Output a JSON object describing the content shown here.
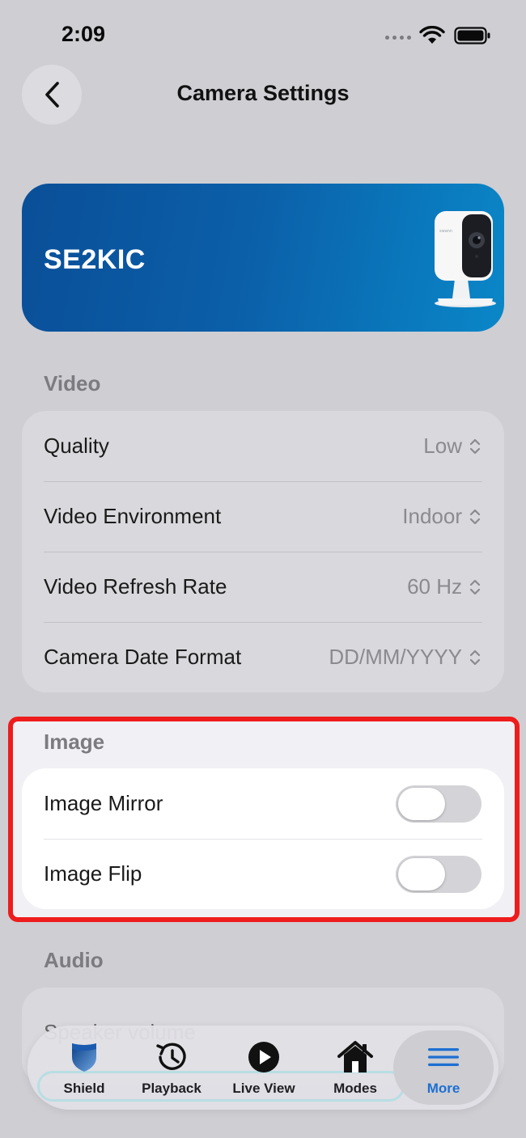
{
  "status_bar": {
    "time": "2:09"
  },
  "header": {
    "title": "Camera Settings"
  },
  "camera": {
    "name": "SE2KIC",
    "brand_mark": "swann"
  },
  "video": {
    "header": "Video",
    "rows": [
      {
        "label": "Quality",
        "value": "Low"
      },
      {
        "label": "Video Environment",
        "value": "Indoor"
      },
      {
        "label": "Video Refresh Rate",
        "value": "60 Hz"
      },
      {
        "label": "Camera Date Format",
        "value": "DD/MM/YYYY"
      }
    ]
  },
  "image": {
    "header": "Image",
    "rows": [
      {
        "label": "Image Mirror",
        "toggle_on": false
      },
      {
        "label": "Image Flip",
        "toggle_on": false
      }
    ]
  },
  "audio": {
    "header": "Audio",
    "partial_row": "Speaker volume"
  },
  "tabs": [
    {
      "label": "Shield",
      "icon": "shield-icon"
    },
    {
      "label": "Playback",
      "icon": "history-icon"
    },
    {
      "label": "Live View",
      "icon": "play-circle-icon"
    },
    {
      "label": "Modes",
      "icon": "home-icon"
    },
    {
      "label": "More",
      "icon": "menu-icon",
      "selected": true
    }
  ],
  "colors": {
    "accent": "#1d6fd1",
    "highlight": "#ee1c1c",
    "card_start": "#0a4f98",
    "card_end": "#0a87c8"
  }
}
